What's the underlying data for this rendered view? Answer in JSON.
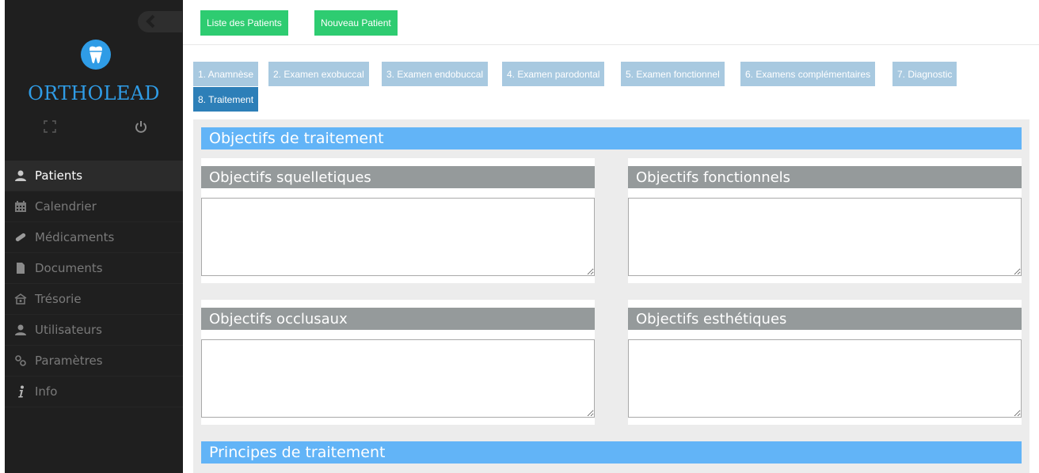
{
  "brand": {
    "name": "ORTHOLEAD"
  },
  "sidebar": {
    "items": [
      {
        "label": "Patients",
        "icon": "user-icon",
        "active": true
      },
      {
        "label": "Calendrier",
        "icon": "calendar-icon",
        "active": false
      },
      {
        "label": "Médicaments",
        "icon": "pill-icon",
        "active": false
      },
      {
        "label": "Documents",
        "icon": "document-icon",
        "active": false
      },
      {
        "label": "Trésorie",
        "icon": "safe-icon",
        "active": false
      },
      {
        "label": "Utilisateurs",
        "icon": "users-icon",
        "active": false
      },
      {
        "label": "Paramètres",
        "icon": "cogs-icon",
        "active": false
      },
      {
        "label": "Info",
        "icon": "info-icon",
        "active": false
      }
    ]
  },
  "toolbar": {
    "list_label": "Liste des Patients",
    "new_label": "Nouveau Patient"
  },
  "tabs": [
    {
      "label": "1. Anamnèse"
    },
    {
      "label": "2. Examen exobuccal"
    },
    {
      "label": "3. Examen endobuccal"
    },
    {
      "label": "4. Examen parodontal"
    },
    {
      "label": "5. Examen fonctionnel"
    },
    {
      "label": "6. Examens complémentaires"
    },
    {
      "label": "7. Diagnostic"
    },
    {
      "label": "8. Traitement",
      "active": true
    }
  ],
  "main": {
    "section1": "Objectifs de traitement",
    "cards": [
      {
        "title": "Objectifs squelletiques",
        "value": ""
      },
      {
        "title": "Objectifs fonctionnels",
        "value": ""
      },
      {
        "title": "Objectifs occlusaux",
        "value": ""
      },
      {
        "title": "Objectifs esthétiques",
        "value": ""
      }
    ],
    "section2": "Principes de traitement"
  },
  "colors": {
    "sidebar_bg": "#1f1f1f",
    "brand": "#2f9ce6",
    "button_green": "#2ecc71",
    "tab": "#a8c9e0",
    "tab_active": "#2d7fb8",
    "section_header": "#62b4f7",
    "card_title": "#959a9b"
  }
}
